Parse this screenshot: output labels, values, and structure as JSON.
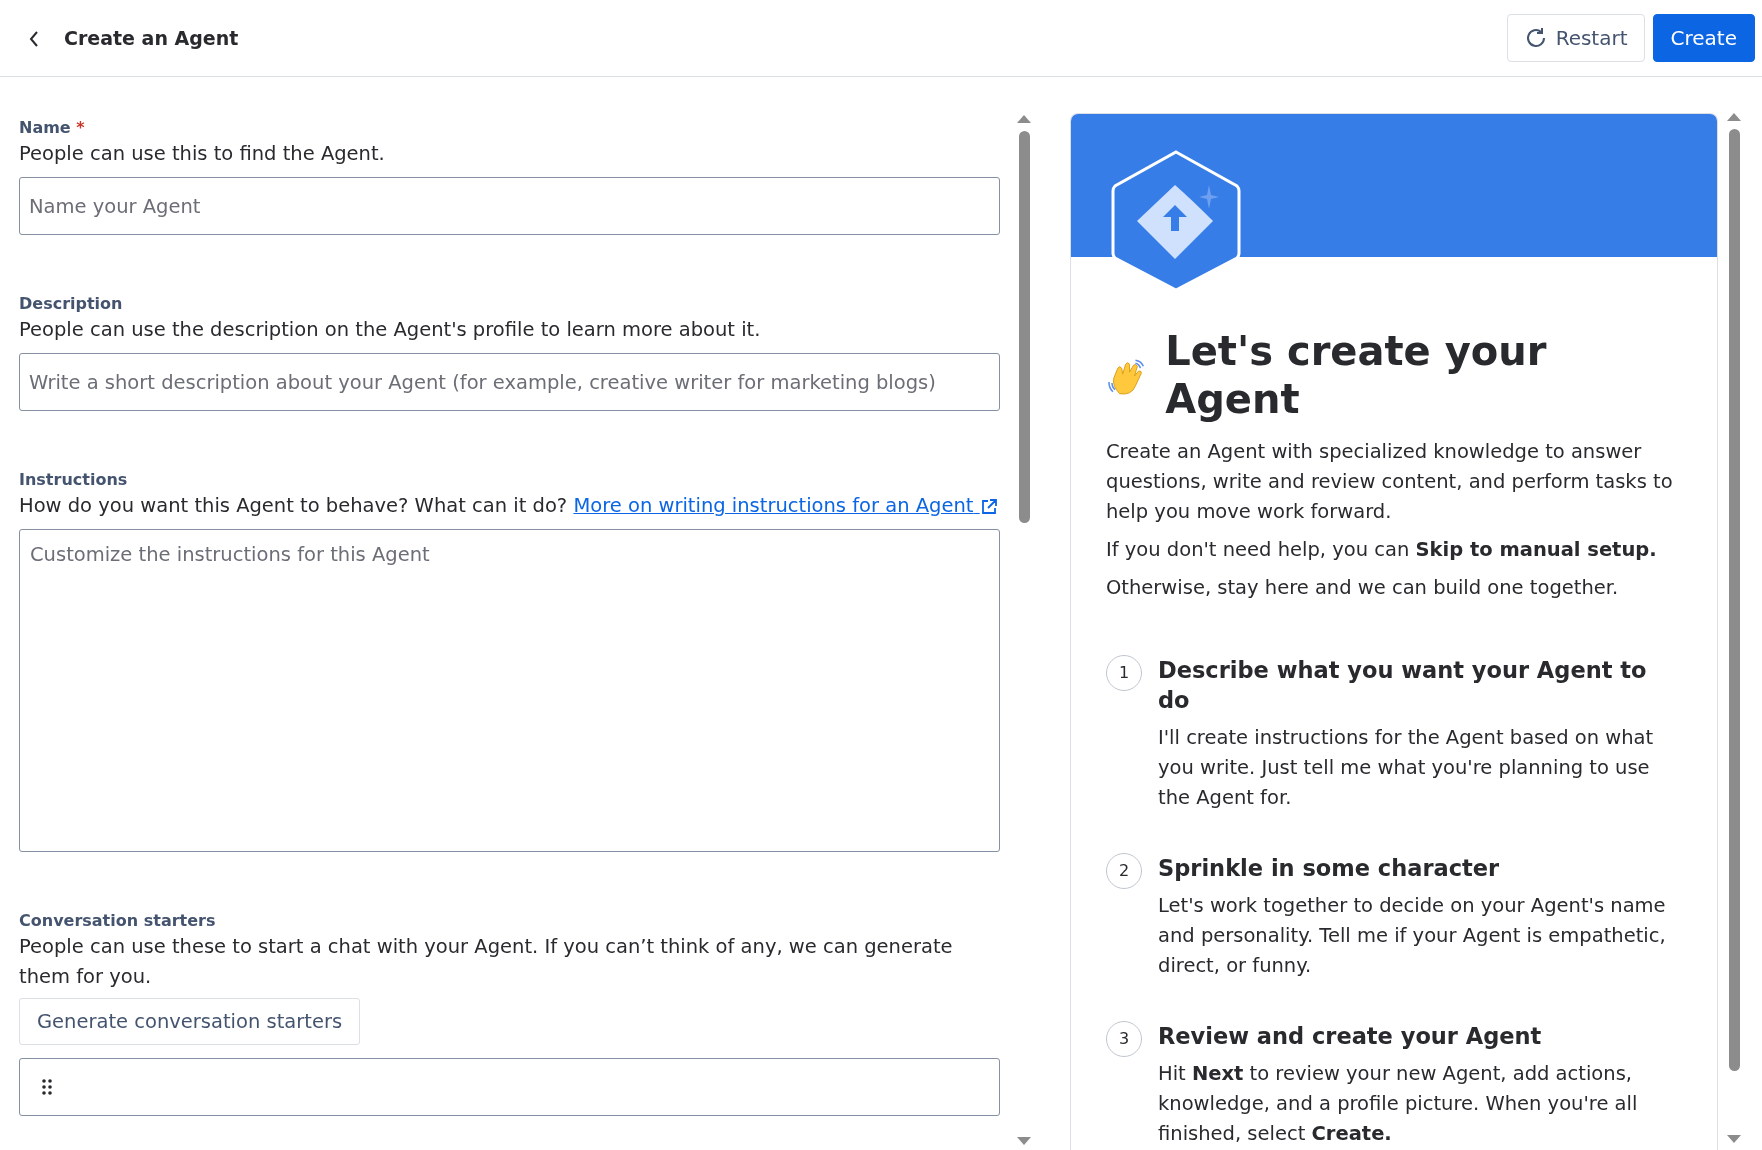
{
  "header": {
    "title": "Create an Agent",
    "buttons": [
      {
        "label": "Restart",
        "kind": "secondary"
      },
      {
        "label": "Create",
        "kind": "primary"
      }
    ]
  },
  "form": {
    "fields": [
      {
        "kind": "input",
        "label": "Name",
        "required_mark": "*",
        "help": "People can use this to find the Agent.",
        "placeholder": "Name your Agent"
      },
      {
        "kind": "input",
        "label": "Description",
        "help": "People can use the description on the Agent's profile to learn more about it.",
        "placeholder": "Write a short description about your Agent (for example, creative writer for marketing blogs)"
      },
      {
        "kind": "textarea",
        "label": "Instructions",
        "help": "How do you want this Agent to behave? What can it do?",
        "link": "More on writing instructions for an Agent",
        "placeholder": "Customize the instructions for this Agent"
      },
      {
        "kind": "starters",
        "label": "Conversation starters",
        "help": "People can use these to start a chat with your Agent. If you can’t think of any, we can generate them for you.",
        "button": "Generate conversation starters"
      }
    ]
  },
  "intro": {
    "title": "Let's create your Agent",
    "paragraphs": [
      "Create an Agent with specialized knowledge to answer questions, write and review content, and perform tasks to help you move work forward.",
      "If you don't need help, you can **Skip to manual setup.**",
      "Otherwise, stay here and we can build one together."
    ],
    "steps": [
      {
        "number": "1",
        "title": "Describe what you want your Agent to do",
        "text": "I'll create instructions for the Agent based on what you write. Just tell me what you're planning to use the Agent for."
      },
      {
        "number": "2",
        "title": "Sprinkle in some character",
        "text": "Let's work together to decide on your Agent's name and personality. Tell me if your Agent is empathetic, direct, or funny."
      },
      {
        "number": "3",
        "title": "Review and create your Agent",
        "text": "Hit **Next** to review your new Agent, add actions, knowledge, and a profile picture. When you're all finished, select **Create.**"
      }
    ]
  }
}
